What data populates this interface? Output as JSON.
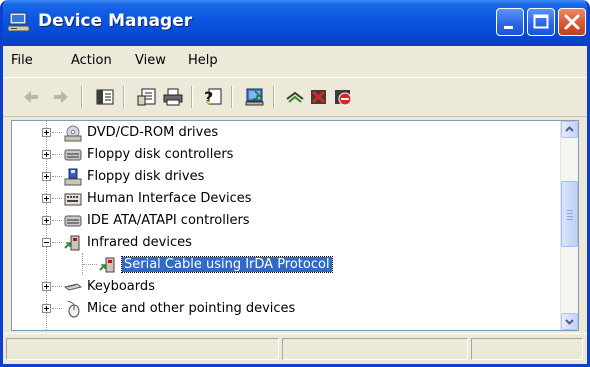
{
  "window": {
    "title": "Device Manager"
  },
  "menu": {
    "items": [
      "File",
      "Action",
      "View",
      "Help"
    ]
  },
  "toolbar": {
    "icons": [
      "back-arrow-icon",
      "forward-arrow-icon",
      "show-hide-console-tree-icon",
      "properties-icon",
      "print-icon",
      "help-icon",
      "scan-hardware-changes-icon",
      "update-driver-icon",
      "uninstall-icon",
      "disable-icon"
    ]
  },
  "tree": {
    "items": [
      {
        "label": "DVD/CD-ROM drives",
        "icon": "cdrom-drive-icon"
      },
      {
        "label": "Floppy disk controllers",
        "icon": "disk-controller-icon"
      },
      {
        "label": "Floppy disk drives",
        "icon": "floppy-drive-icon"
      },
      {
        "label": "Human Interface Devices",
        "icon": "hid-keyboard-icon"
      },
      {
        "label": "IDE ATA/ATAPI controllers",
        "icon": "ide-controller-icon"
      },
      {
        "label": "Infrared devices",
        "icon": "infrared-device-icon",
        "expanded": true
      },
      {
        "label": "Serial Cable using IrDA Protocol",
        "icon": "infrared-device-icon",
        "selected": true
      },
      {
        "label": "Keyboards",
        "icon": "keyboard-icon"
      },
      {
        "label": "Mice and other pointing devices",
        "icon": "mouse-icon"
      }
    ]
  },
  "colors": {
    "title_bar": "#0a55e0",
    "selection": "#316ac5",
    "close_button": "#d6532d"
  }
}
